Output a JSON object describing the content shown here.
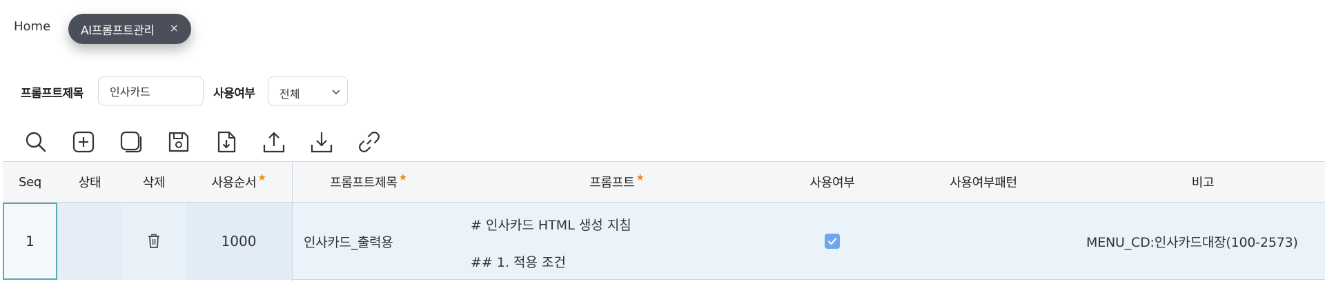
{
  "tabs": {
    "home_label": "Home",
    "active_label": "AI프롬프트관리",
    "close_symbol": "×"
  },
  "search": {
    "title_label": "프롬프트제목",
    "title_value": "인사카드",
    "use_label": "사용여부",
    "use_value": "전체"
  },
  "toolbar": {
    "icons": [
      "search-icon",
      "add-icon",
      "copy-icon",
      "save-icon",
      "file-download-icon",
      "upload-icon",
      "download-icon",
      "link-icon"
    ]
  },
  "grid": {
    "columns": {
      "seq": "Seq",
      "status": "상태",
      "delete": "삭제",
      "order": "사용순서",
      "title": "프롬프트제목",
      "prompt": "프롬프트",
      "use": "사용여부",
      "use_pattern": "사용여부패턴",
      "note": "비고"
    },
    "required_marker": "★",
    "rows": [
      {
        "seq": "1",
        "status": "",
        "order": "1000",
        "title": "인사카드_출력용",
        "prompt_line1": "# 인사카드 HTML 생성 지침",
        "prompt_line2": "## 1. 적용 조건",
        "use_checked": true,
        "use_pattern": "",
        "note": "MENU_CD:인사카드대장(100-2573)"
      }
    ]
  },
  "colors": {
    "active_tab": "#4a4f5a",
    "required_star": "#f08c1a",
    "checkbox": "#6fa6ec",
    "selected_cell_border": "#5aa8b4"
  }
}
